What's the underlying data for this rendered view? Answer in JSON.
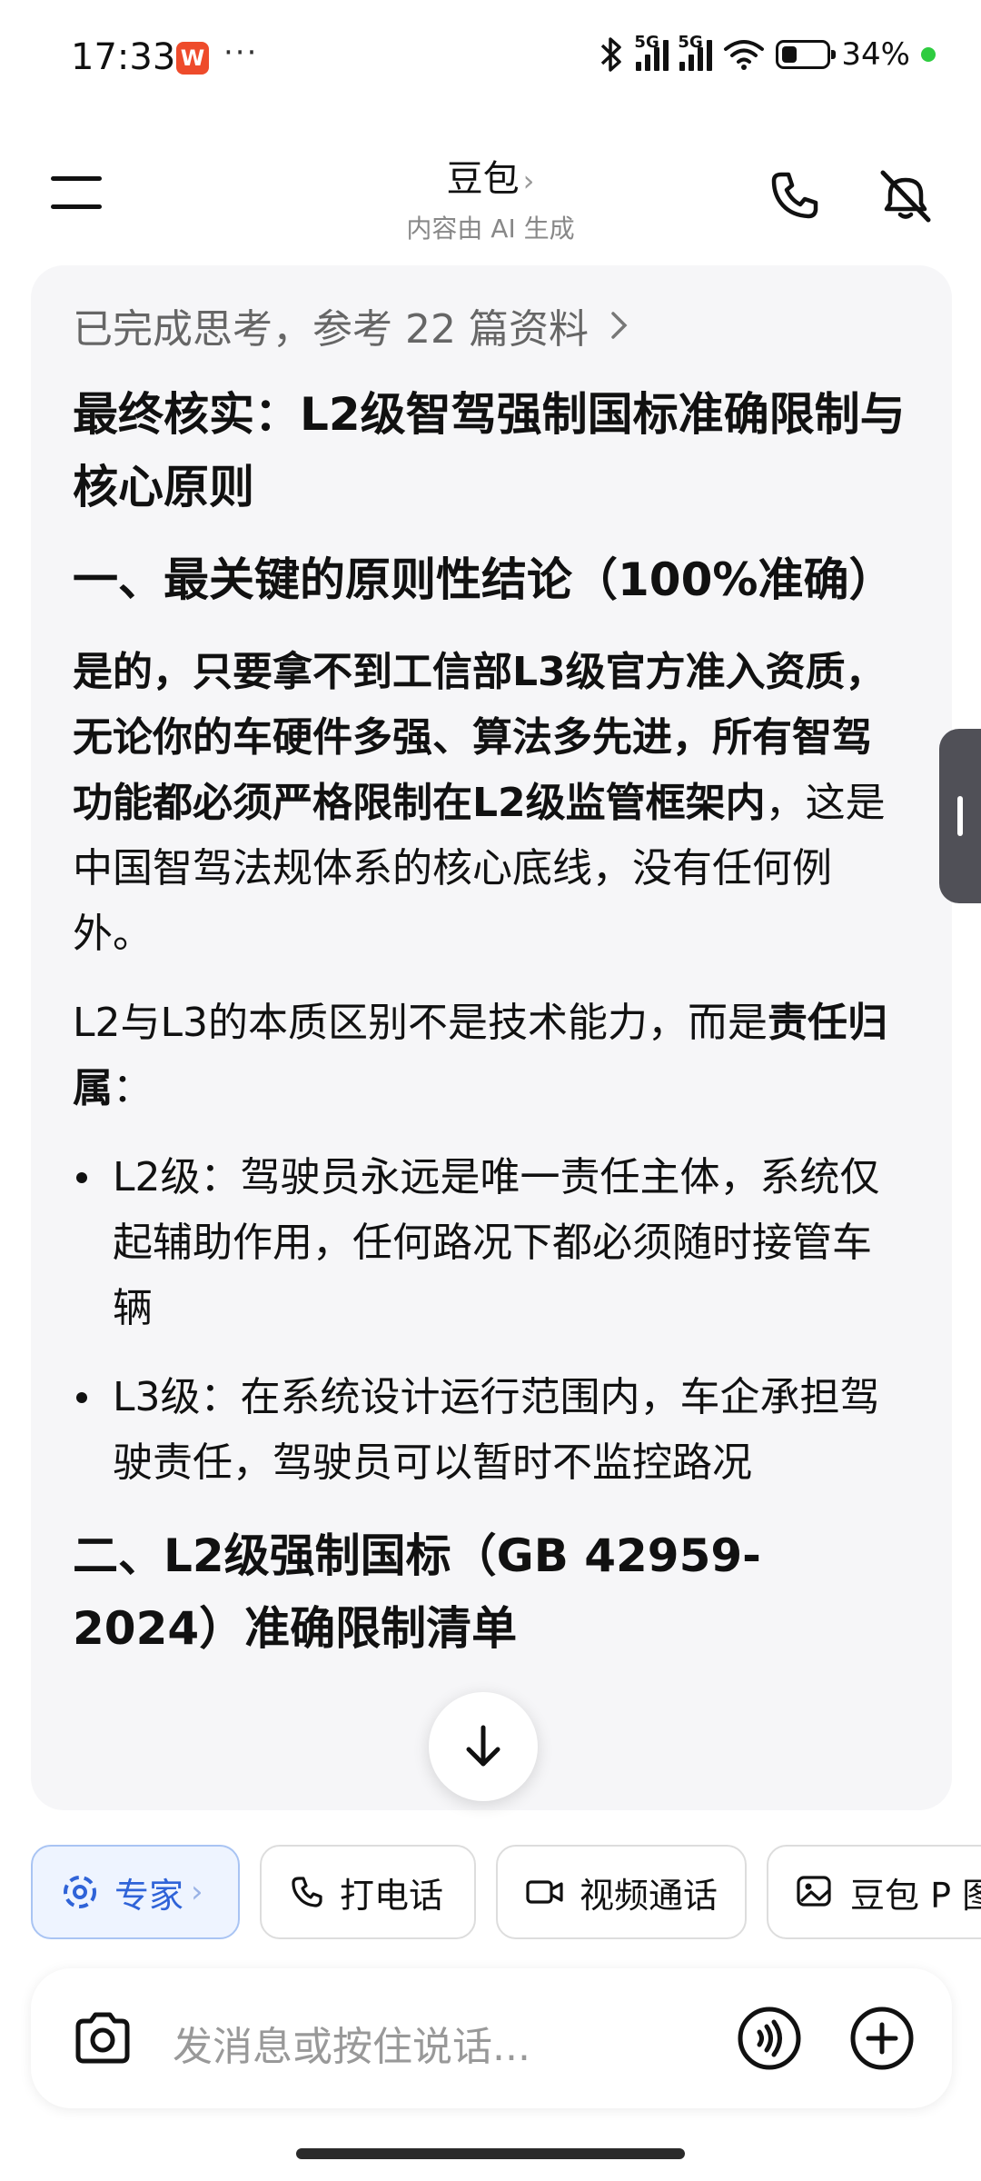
{
  "status_bar": {
    "time": "17:33",
    "app_badge": "W",
    "dots": "···",
    "network_1": "5G",
    "network_2": "5G",
    "battery_pct": "34%",
    "battery_level": 0.34,
    "icons": [
      "bluetooth-icon",
      "signal-icon",
      "wifi-icon",
      "battery-icon"
    ]
  },
  "header": {
    "title": "豆包",
    "subtitle": "内容由 AI 生成"
  },
  "message": {
    "thinking_summary": "已完成思考，参考 22 篇资料",
    "heading": "最终核实：L2级智驾强制国标准确限制与核心原则",
    "section1_title": "一、最关键的原则性结论（100%准确）",
    "para1_bold": "是的，只要拿不到工信部L3级官方准入资质，无论你的车硬件多强、算法多先进，所有智驾功能都必须严格限制在L2级监管框架内",
    "para1_rest": "，这是中国智驾法规体系的核心底线，没有任何例外。",
    "para2_start": "L2与L3的本质区别不是技术能力，而是",
    "para2_bold": "责任归属",
    "para2_end": "：",
    "bullets": [
      "L2级：驾驶员永远是唯一责任主体，系统仅起辅助作用，任何路况下都必须随时接管车辆",
      "L3级：在系统设计运行范围内，车企承担驾驶责任，驾驶员可以暂时不监控路况"
    ],
    "section2_title": "二、L2级强制国标（GB 42959-2024）准确限制清单"
  },
  "chips": {
    "expert": "专家",
    "call": "打电话",
    "video": "视频通话",
    "pic": "豆包 P 图"
  },
  "input": {
    "placeholder": "发消息或按住说话..."
  }
}
